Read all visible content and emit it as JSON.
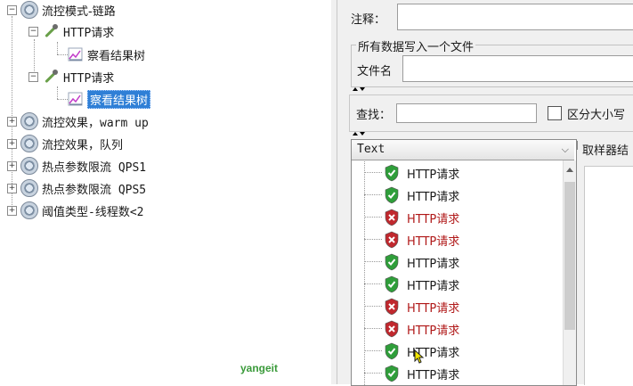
{
  "colors": {
    "selection": "#2f7fd6",
    "error_text": "#b01818",
    "ok_shield": "#2f9e3a",
    "error_shield": "#c0282e",
    "watermark": "#3a9a3a"
  },
  "tree": {
    "items": [
      {
        "label": "流控模式-链路",
        "icon": "gear-icon"
      },
      {
        "label": "HTTP请求",
        "icon": "dropper-icon"
      },
      {
        "label": "察看结果树",
        "icon": "listener-icon"
      },
      {
        "label": "HTTP请求",
        "icon": "dropper-icon"
      },
      {
        "label": "察看结果树",
        "icon": "listener-icon",
        "selected": true
      },
      {
        "label": "流控效果，warm up",
        "icon": "gear-icon"
      },
      {
        "label": "流控效果，队列",
        "icon": "gear-icon"
      },
      {
        "label": "热点参数限流 QPS1",
        "icon": "gear-icon"
      },
      {
        "label": "热点参数限流 QPS5",
        "icon": "gear-icon"
      },
      {
        "label": "阈值类型-线程数<2",
        "icon": "gear-icon"
      }
    ]
  },
  "form": {
    "comment_label": "注释：",
    "comment_value": "",
    "group_title": "所有数据写入一个文件",
    "filename_label": "文件名",
    "filename_value": "",
    "search_label": "查找：",
    "search_value": "",
    "case_sensitive_label": "区分大小写",
    "case_sensitive_checked": false
  },
  "results": {
    "renderer": "Text",
    "rows": [
      {
        "label": "HTTP请求",
        "status": "ok"
      },
      {
        "label": "HTTP请求",
        "status": "ok"
      },
      {
        "label": "HTTP请求",
        "status": "error"
      },
      {
        "label": "HTTP请求",
        "status": "error"
      },
      {
        "label": "HTTP请求",
        "status": "ok"
      },
      {
        "label": "HTTP请求",
        "status": "ok"
      },
      {
        "label": "HTTP请求",
        "status": "error"
      },
      {
        "label": "HTTP请求",
        "status": "error"
      },
      {
        "label": "HTTP请求",
        "status": "ok"
      },
      {
        "label": "HTTP请求",
        "status": "ok"
      }
    ]
  },
  "sampler": {
    "tab_label": "取样器结"
  },
  "watermark": "yangeit"
}
